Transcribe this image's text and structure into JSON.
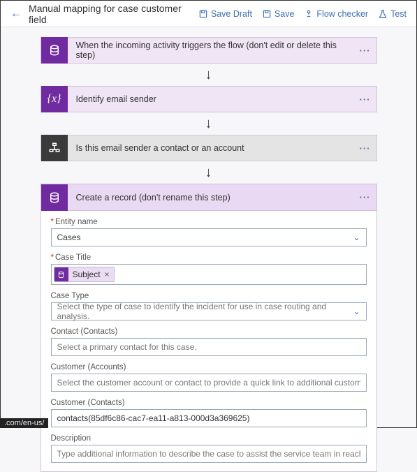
{
  "header": {
    "title": "Manual mapping for case customer field",
    "actions": {
      "saveDraft": "Save Draft",
      "save": "Save",
      "flowChecker": "Flow checker",
      "test": "Test"
    }
  },
  "steps": {
    "s1": {
      "label": "When the incoming activity triggers the flow (don't edit or delete this step)"
    },
    "s2": {
      "label": "Identify email sender"
    },
    "s3": {
      "label": "Is this email sender a contact or an account"
    },
    "s4": {
      "label": "Create a record (don't rename this step)"
    }
  },
  "form": {
    "entityName": {
      "label": "Entity name",
      "value": "Cases"
    },
    "caseTitle": {
      "label": "Case Title",
      "token": "Subject"
    },
    "caseType": {
      "label": "Case Type",
      "placeholder": "Select the type of case to identify the incident for use in case routing and analysis."
    },
    "contact": {
      "label": "Contact (Contacts)",
      "placeholder": "Select a primary contact for this case."
    },
    "customerAccounts": {
      "label": "Customer (Accounts)",
      "placeholder": "Select the customer account or contact to provide a quick link to additional customer details, such as ac"
    },
    "customerContacts": {
      "label": "Customer (Contacts)",
      "value": "contacts(85df6c86-cac7-ea11-a813-000d3a369625)"
    },
    "description": {
      "label": "Description",
      "placeholder": "Type additional information to describe the case to assist the service team in reaching a resolution."
    }
  },
  "statusBar": ".com/en-us/"
}
